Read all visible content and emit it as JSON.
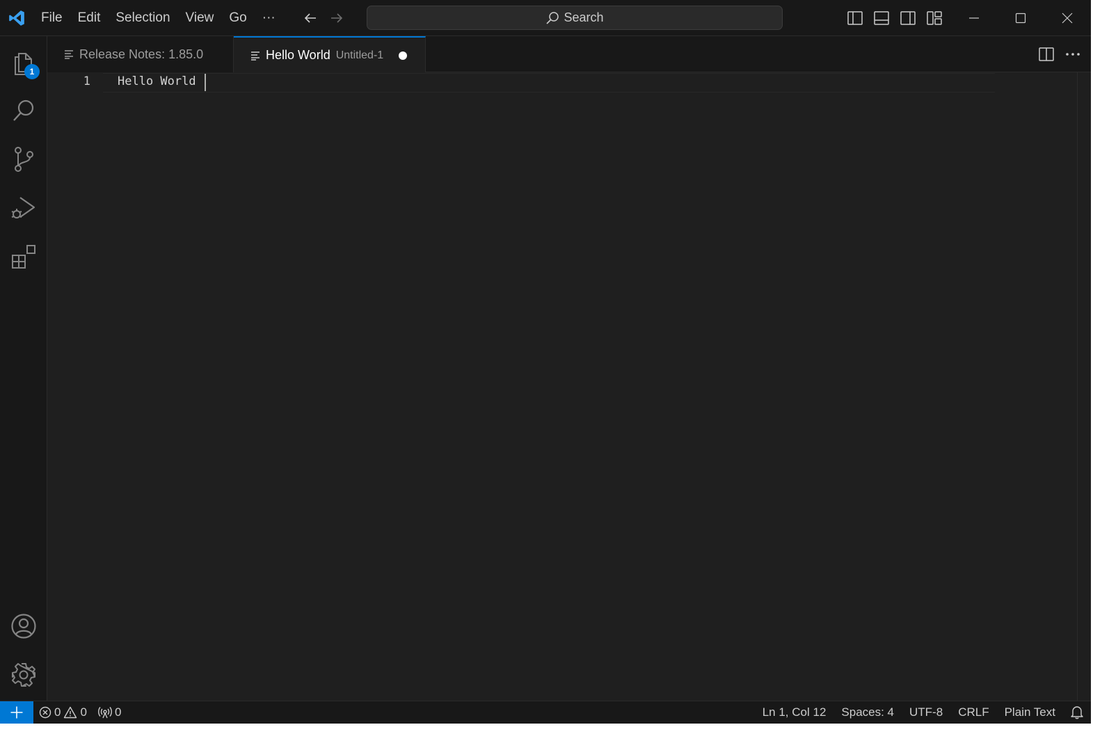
{
  "titlebar": {
    "menu": [
      "File",
      "Edit",
      "Selection",
      "View",
      "Go",
      "···"
    ],
    "search_placeholder": "Search"
  },
  "activity_bar": {
    "items": [
      {
        "icon": "files-icon",
        "label": "Explorer",
        "badge": "1"
      },
      {
        "icon": "search-icon",
        "label": "Search"
      },
      {
        "icon": "source-control-icon",
        "label": "Source Control"
      },
      {
        "icon": "run-debug-icon",
        "label": "Run and Debug"
      },
      {
        "icon": "extensions-icon",
        "label": "Extensions"
      }
    ],
    "bottom_items": [
      {
        "icon": "account-icon",
        "label": "Accounts"
      },
      {
        "icon": "gear-icon",
        "label": "Manage"
      }
    ]
  },
  "tabs": [
    {
      "label": "Release Notes: 1.85.0",
      "active": false
    },
    {
      "label": "Hello World",
      "description": "Untitled-1",
      "active": true,
      "dirty": true
    }
  ],
  "editor": {
    "lines": [
      {
        "number": "1",
        "text": "Hello World"
      }
    ]
  },
  "statusbar": {
    "errors": "0",
    "warnings": "0",
    "ports": "0",
    "position": "Ln 1, Col 12",
    "indent": "Spaces: 4",
    "encoding": "UTF-8",
    "eol": "CRLF",
    "language": "Plain Text"
  },
  "colors": {
    "accent": "#0078d4",
    "background": "#1f1f1f",
    "chrome": "#181818"
  }
}
